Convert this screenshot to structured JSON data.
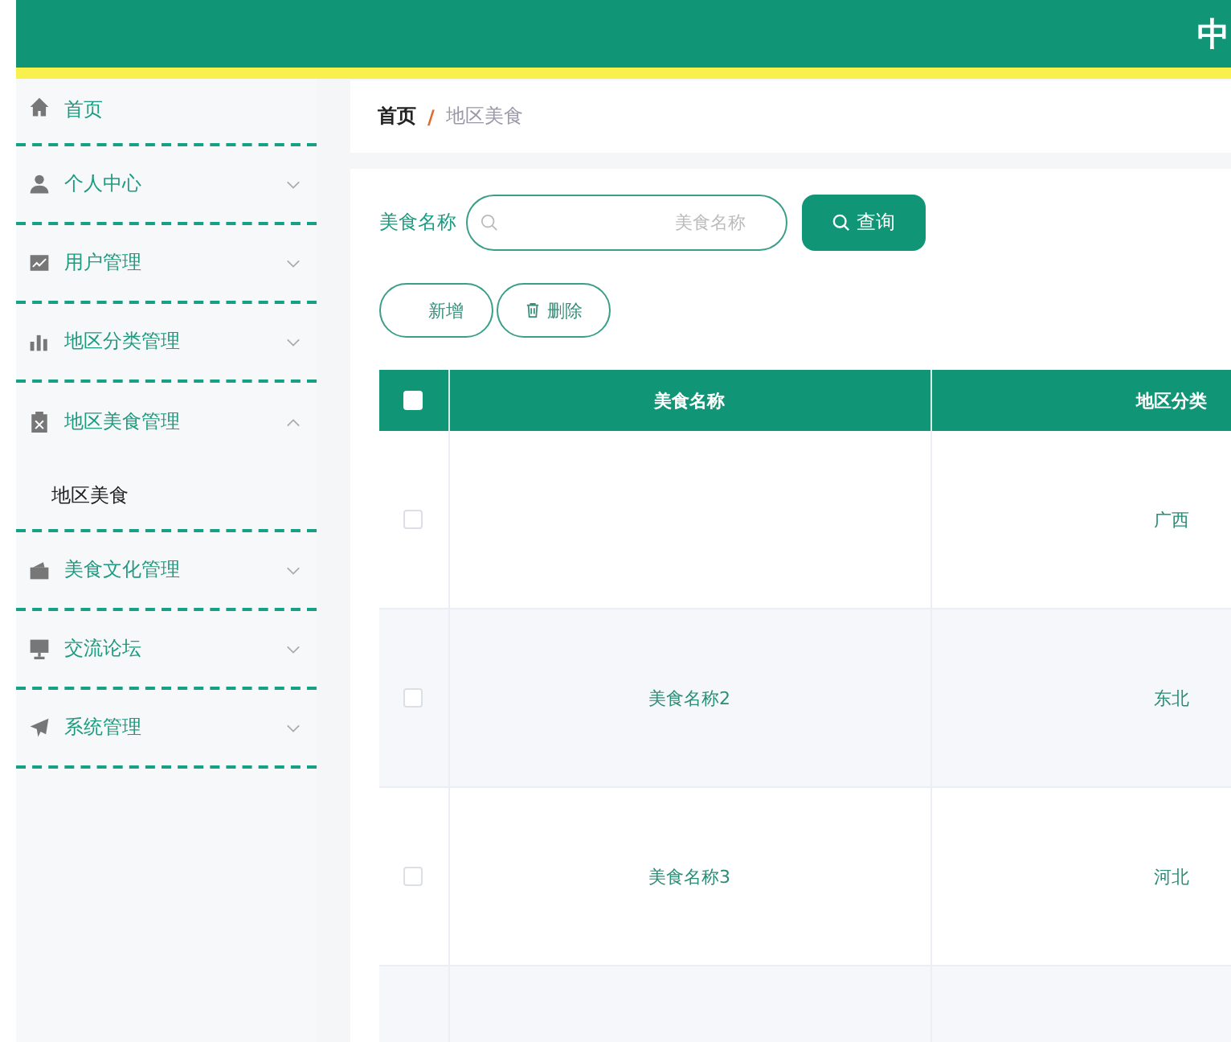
{
  "header": {
    "title": "中"
  },
  "sidebar": {
    "items": [
      {
        "label": "首页",
        "kind": "link"
      },
      {
        "label": "个人中心",
        "kind": "menu",
        "expanded": false
      },
      {
        "label": "用户管理",
        "kind": "menu",
        "expanded": false
      },
      {
        "label": "地区分类管理",
        "kind": "menu",
        "expanded": false
      },
      {
        "label": "地区美食管理",
        "kind": "menu",
        "expanded": true,
        "children": [
          {
            "label": "地区美食"
          }
        ]
      },
      {
        "label": "美食文化管理",
        "kind": "menu",
        "expanded": false
      },
      {
        "label": "交流论坛",
        "kind": "menu",
        "expanded": false
      },
      {
        "label": "系统管理",
        "kind": "menu",
        "expanded": false
      }
    ]
  },
  "breadcrumb": {
    "items": [
      "首页",
      "地区美食"
    ],
    "separator": "/"
  },
  "search": {
    "label": "美食名称",
    "placeholder": "美食名称",
    "button": "查询"
  },
  "actions": [
    "新增",
    "删除"
  ],
  "table": {
    "all_checked": false,
    "columns": [
      "美食名称",
      "地区分类"
    ],
    "rows": [
      {
        "checked": false,
        "region": "广西"
      },
      {
        "checked": false,
        "name": "美食名称2",
        "region": "东北"
      },
      {
        "checked": false,
        "name": "美食名称3",
        "region": "河北"
      },
      {}
    ]
  }
}
